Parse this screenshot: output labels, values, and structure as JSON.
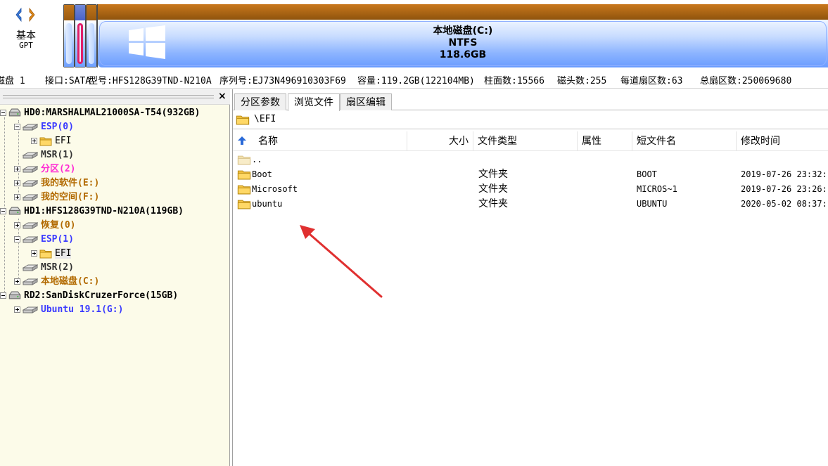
{
  "disk_map": {
    "disk_type_line1": "基本",
    "disk_type_line2": "GPT",
    "main_partition": {
      "name": "本地磁盘(C:)",
      "fs": "NTFS",
      "size": "118.6GB"
    }
  },
  "infobar": {
    "disk": "磁盘 1",
    "interface": "接口:SATA",
    "model": "型号:HFS128G39TND-N210A",
    "serial": "序列号:EJ73N496910303F69",
    "capacity": "容量:119.2GB(122104MB)",
    "cylinders": "柱面数:15566",
    "heads": "磁头数:255",
    "sectors_per_track": "每道扇区数:63",
    "total_sectors": "总扇区数:250069680"
  },
  "tree": {
    "close_label": "×",
    "items": [
      {
        "label": "HD0:MARSHALMAL21000SA-T54(932GB)"
      },
      {
        "label": "ESP(0)"
      },
      {
        "label": "EFI"
      },
      {
        "label": "MSR(1)"
      },
      {
        "label": "分区(2)"
      },
      {
        "label": "我的软件(E:)"
      },
      {
        "label": "我的空间(F:)"
      },
      {
        "label": "HD1:HFS128G39TND-N210A(119GB)"
      },
      {
        "label": "恢复(0)"
      },
      {
        "label": "ESP(1)"
      },
      {
        "label": "EFI"
      },
      {
        "label": "MSR(2)"
      },
      {
        "label": "本地磁盘(C:)"
      },
      {
        "label": "RD2:SanDiskCruzerForce(15GB)"
      },
      {
        "label": "Ubuntu 19.1(G:)"
      }
    ]
  },
  "tabs": [
    {
      "label": "分区参数"
    },
    {
      "label": "浏览文件"
    },
    {
      "label": "扇区编辑"
    }
  ],
  "path": "\\EFI",
  "columns": [
    "名称",
    "大小",
    "文件类型",
    "属性",
    "短文件名",
    "修改时间"
  ],
  "files": [
    {
      "name": "..",
      "size": "",
      "type": "",
      "attr": "",
      "short": "",
      "mtime": ""
    },
    {
      "name": "Boot",
      "size": "",
      "type": "文件夹",
      "attr": "",
      "short": "BOOT",
      "mtime": "2019-07-26 23:32:"
    },
    {
      "name": "Microsoft",
      "size": "",
      "type": "文件夹",
      "attr": "",
      "short": "MICROS~1",
      "mtime": "2019-07-26 23:26:"
    },
    {
      "name": "ubuntu",
      "size": "",
      "type": "文件夹",
      "attr": "",
      "short": "UBUNTU",
      "mtime": "2020-05-02 08:37:"
    }
  ],
  "colors": {
    "partition_cap": "#b06a14",
    "partition_body": "#8cb4ff",
    "selected_border": "#e0206a",
    "annotation_arrow": "#e03030",
    "tree_bg": "#fcfbe9"
  }
}
